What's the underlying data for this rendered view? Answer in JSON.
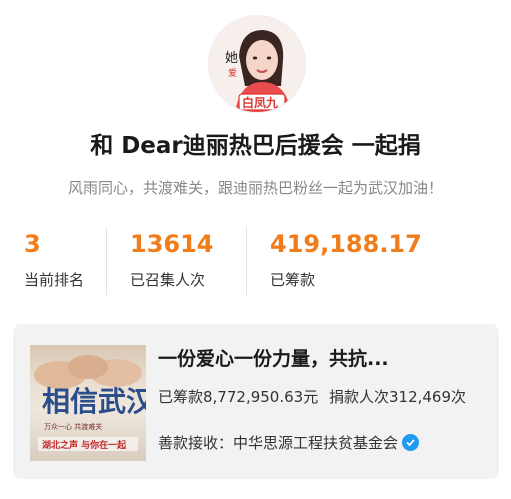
{
  "header": {
    "title": "和 Dear迪丽热巴后援会 一起捐",
    "subtitle": "风雨同心，共渡难关，跟迪丽热巴粉丝一起为武汉加油！"
  },
  "stats": [
    {
      "value": "3",
      "label": "当前排名"
    },
    {
      "value": "13614",
      "label": "已召集人次"
    },
    {
      "value": "419,188.17",
      "label": "已筹款"
    }
  ],
  "project": {
    "title": "一份爱心一份力量，共抗...",
    "raised": "已筹款8,772,950.63元",
    "donors": "捐款人次312,469次",
    "org_label": "善款接收：",
    "org_name": "中华思源工程扶贫基金会",
    "thumb_text_main": "相信武汉",
    "thumb_text_small": "万众一心 共渡难关",
    "thumb_text_bottom": "湖北之声 与你在一起"
  },
  "colors": {
    "accent": "#f07c1a",
    "verified": "#1d9bf0"
  }
}
